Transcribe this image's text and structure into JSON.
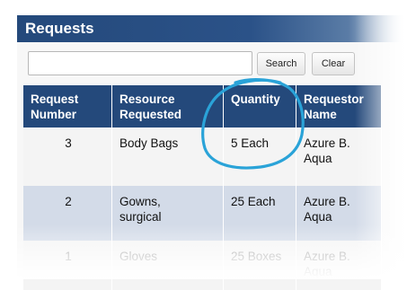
{
  "panel": {
    "title": "Requests"
  },
  "search": {
    "value": "",
    "search_label": "Search",
    "clear_label": "Clear"
  },
  "table": {
    "headers": {
      "number": [
        "Request",
        "Number"
      ],
      "resource": [
        "Resource",
        "Requested"
      ],
      "quantity": "Quantity",
      "requestor": [
        "Requestor",
        "Name"
      ]
    },
    "rows": [
      {
        "number": "3",
        "resource": "Body Bags",
        "quantity": "5 Each",
        "requestor": [
          "Azure B.",
          "Aqua"
        ]
      },
      {
        "number": "2",
        "resource": [
          "Gowns,",
          "surgical"
        ],
        "quantity": "25 Each",
        "requestor": [
          "Azure B.",
          "Aqua"
        ]
      },
      {
        "number": "1",
        "resource": "Gloves",
        "quantity": "25 Boxes",
        "requestor": [
          "Azure B.",
          "Aqua"
        ]
      }
    ]
  },
  "colors": {
    "header": "#24497b",
    "highlight_row": "#d3dbe8",
    "annotation": "#2aa3d8"
  }
}
